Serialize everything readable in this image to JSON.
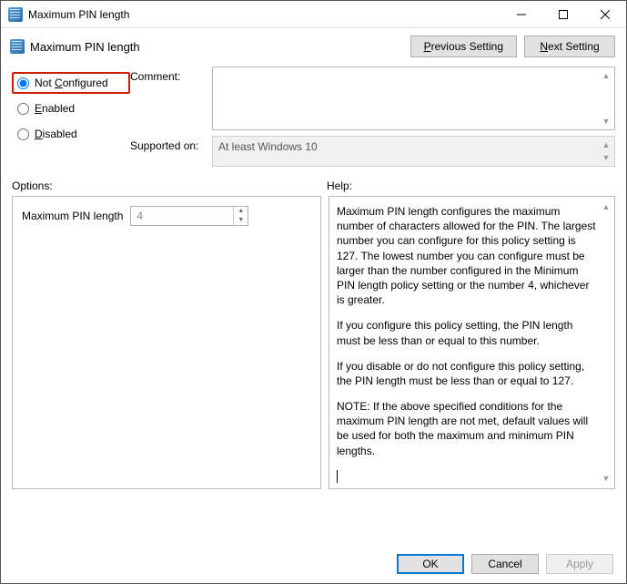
{
  "window": {
    "title": "Maximum PIN length"
  },
  "header": {
    "title": "Maximum PIN length",
    "prev_label": "Previous Setting",
    "next_label": "Next Setting"
  },
  "radios": {
    "not_configured": "Not Configured",
    "enabled": "Enabled",
    "disabled": "Disabled",
    "selected": "not_configured"
  },
  "fields": {
    "comment_label": "Comment:",
    "comment_value": "",
    "supported_label": "Supported on:",
    "supported_value": "At least Windows 10"
  },
  "sections": {
    "options_label": "Options:",
    "help_label": "Help:"
  },
  "options": {
    "max_pin_label": "Maximum PIN length",
    "max_pin_value": "4"
  },
  "help": {
    "p1": "Maximum PIN length configures the maximum number of characters allowed for the PIN.  The largest number you can configure for this policy setting is 127. The lowest number you can configure must be larger than the number configured in the Minimum PIN length policy setting or the number 4, whichever is greater.",
    "p2": "If you configure this policy setting, the PIN length must be less than or equal to this number.",
    "p3": "If you disable or do not configure this policy setting, the PIN length must be less than or equal to 127.",
    "p4": "NOTE: If the above specified conditions for the maximum PIN length are not met, default values will be used for both the maximum and minimum PIN lengths."
  },
  "footer": {
    "ok": "OK",
    "cancel": "Cancel",
    "apply": "Apply"
  }
}
